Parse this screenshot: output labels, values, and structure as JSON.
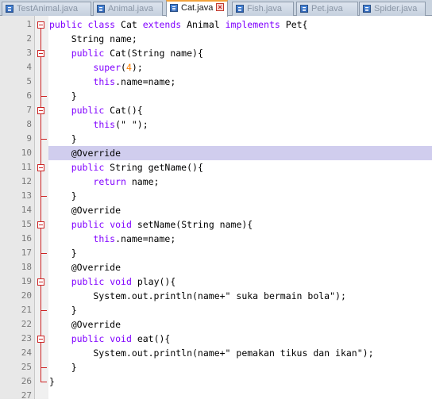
{
  "tabs": [
    {
      "label": "TestAnimal.java",
      "active": false
    },
    {
      "label": "Animal.java",
      "active": false
    },
    {
      "label": "Cat.java",
      "active": true
    },
    {
      "label": "Fish.java",
      "active": false
    },
    {
      "label": "Pet.java",
      "active": false
    },
    {
      "label": "Spider.java",
      "active": false
    }
  ],
  "editor": {
    "highlighted_line": 10,
    "lines": [
      {
        "n": "1",
        "code": "public class Cat extends Animal implements Pet{"
      },
      {
        "n": "2",
        "code": "    String name;"
      },
      {
        "n": "3",
        "code": "    public Cat(String name){"
      },
      {
        "n": "4",
        "code": "        super(4);"
      },
      {
        "n": "5",
        "code": "        this.name=name;"
      },
      {
        "n": "6",
        "code": "    }"
      },
      {
        "n": "7",
        "code": "    public Cat(){"
      },
      {
        "n": "8",
        "code": "        this(\" \");"
      },
      {
        "n": "9",
        "code": "    }"
      },
      {
        "n": "10",
        "code": "    @Override"
      },
      {
        "n": "11",
        "code": "    public String getName(){"
      },
      {
        "n": "12",
        "code": "        return name;"
      },
      {
        "n": "13",
        "code": "    }"
      },
      {
        "n": "14",
        "code": "    @Override"
      },
      {
        "n": "15",
        "code": "    public void setName(String name){"
      },
      {
        "n": "16",
        "code": "        this.name=name;"
      },
      {
        "n": "17",
        "code": "    }"
      },
      {
        "n": "18",
        "code": "    @Override"
      },
      {
        "n": "19",
        "code": "    public void play(){"
      },
      {
        "n": "20",
        "code": "        System.out.println(name+\" suka bermain bola\");"
      },
      {
        "n": "21",
        "code": "    }"
      },
      {
        "n": "22",
        "code": "    @Override"
      },
      {
        "n": "23",
        "code": "    public void eat(){"
      },
      {
        "n": "24",
        "code": "        System.out.println(name+\" pemakan tikus dan ikan\");"
      },
      {
        "n": "25",
        "code": "    }"
      },
      {
        "n": "26",
        "code": "}"
      },
      {
        "n": "27",
        "code": ""
      }
    ]
  },
  "colors": {
    "keyword": "#8000ff",
    "number": "#ff8000",
    "highlight": "#d0cdee",
    "fold": "#cc2222"
  }
}
